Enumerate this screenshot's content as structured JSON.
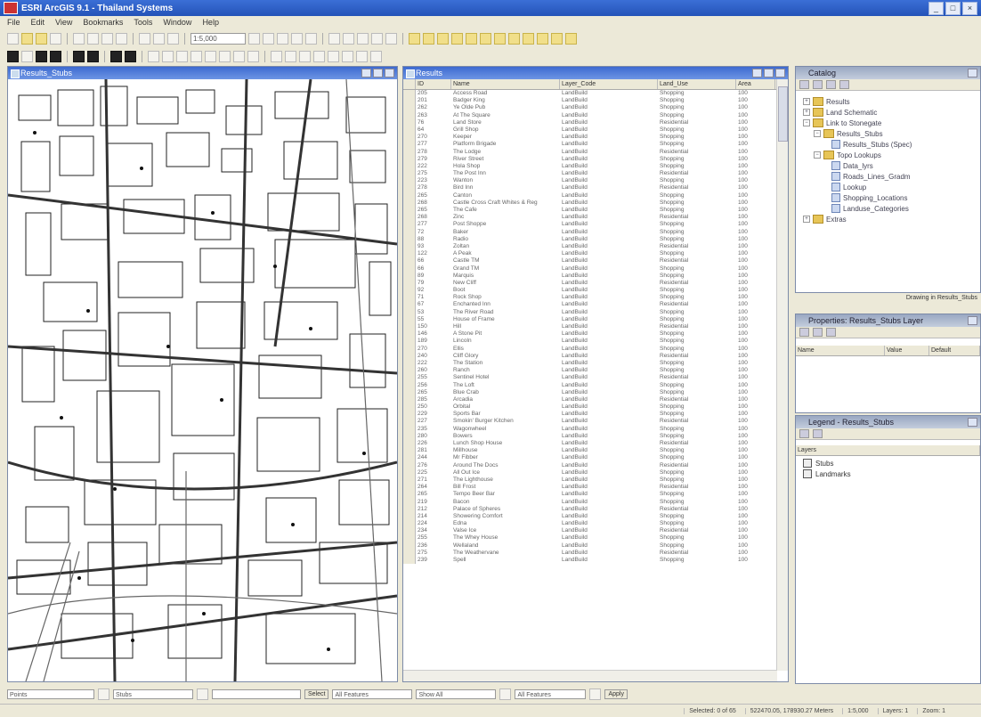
{
  "window": {
    "title": "ESRI ArcGIS 9.1 - Thailand Systems"
  },
  "menu": [
    "File",
    "Edit",
    "View",
    "Bookmarks",
    "Tools",
    "Window",
    "Help"
  ],
  "toolbar": {
    "zoom_value": "1:5,000"
  },
  "map_panel": {
    "title": "Results_Stubs"
  },
  "table_panel": {
    "title": "Results",
    "columns": [
      "ID",
      "Name",
      "Layer_Code",
      "Land_Use",
      "Area"
    ],
    "rows": [
      [
        "205",
        "Access Road",
        "LandBuild",
        "Shopping",
        "100"
      ],
      [
        "201",
        "Badger King",
        "LandBuild",
        "Shopping",
        "100"
      ],
      [
        "262",
        "Ye Olde Pub",
        "LandBuild",
        "Shopping",
        "100"
      ],
      [
        "263",
        "At The Square",
        "LandBuild",
        "Shopping",
        "100"
      ],
      [
        "76",
        "Land Store",
        "LandBuild",
        "Residential",
        "100"
      ],
      [
        "64",
        "Grill Shop",
        "LandBuild",
        "Shopping",
        "100"
      ],
      [
        "270",
        "Keeper",
        "LandBuild",
        "Shopping",
        "100"
      ],
      [
        "277",
        "Platform Brigade",
        "LandBuild",
        "Shopping",
        "100"
      ],
      [
        "278",
        "The Lodge",
        "LandBuild",
        "Residential",
        "100"
      ],
      [
        "279",
        "River Street",
        "LandBuild",
        "Shopping",
        "100"
      ],
      [
        "222",
        "Hola Shop",
        "LandBuild",
        "Shopping",
        "100"
      ],
      [
        "275",
        "The Post Inn",
        "LandBuild",
        "Residential",
        "100"
      ],
      [
        "223",
        "Wanton",
        "LandBuild",
        "Shopping",
        "100"
      ],
      [
        "278",
        "Bird Inn",
        "LandBuild",
        "Residential",
        "100"
      ],
      [
        "265",
        "Canton",
        "LandBuild",
        "Shopping",
        "100"
      ],
      [
        "268",
        "Castle Cross Craft Whites & Reg",
        "LandBuild",
        "Shopping",
        "100"
      ],
      [
        "265",
        "The Cafe",
        "LandBuild",
        "Shopping",
        "100"
      ],
      [
        "268",
        "Zinc",
        "LandBuild",
        "Residential",
        "100"
      ],
      [
        "277",
        "Post Shoppe",
        "LandBuild",
        "Shopping",
        "100"
      ],
      [
        "72",
        "Baker",
        "LandBuild",
        "Shopping",
        "100"
      ],
      [
        "88",
        "Radio",
        "LandBuild",
        "Shopping",
        "100"
      ],
      [
        "93",
        "Zoltan",
        "LandBuild",
        "Residential",
        "100"
      ],
      [
        "122",
        "A Peak",
        "LandBuild",
        "Shopping",
        "100"
      ],
      [
        "66",
        "Castle TM",
        "LandBuild",
        "Residential",
        "100"
      ],
      [
        "66",
        "Grand TM",
        "LandBuild",
        "Shopping",
        "100"
      ],
      [
        "89",
        "Marquis",
        "LandBuild",
        "Shopping",
        "100"
      ],
      [
        "79",
        "New Cliff",
        "LandBuild",
        "Residential",
        "100"
      ],
      [
        "92",
        "Boot",
        "LandBuild",
        "Shopping",
        "100"
      ],
      [
        "71",
        "Rock Shop",
        "LandBuild",
        "Shopping",
        "100"
      ],
      [
        "67",
        "Enchanted Inn",
        "LandBuild",
        "Residential",
        "100"
      ],
      [
        "53",
        "The River Road",
        "LandBuild",
        "Shopping",
        "100"
      ],
      [
        "55",
        "House of Frame",
        "LandBuild",
        "Shopping",
        "100"
      ],
      [
        "150",
        "Hill",
        "LandBuild",
        "Residential",
        "100"
      ],
      [
        "146",
        "A Stone Pit",
        "LandBuild",
        "Shopping",
        "100"
      ],
      [
        "189",
        "Lincoln",
        "LandBuild",
        "Shopping",
        "100"
      ],
      [
        "270",
        "Ellis",
        "LandBuild",
        "Shopping",
        "100"
      ],
      [
        "240",
        "Cliff Glory",
        "LandBuild",
        "Residential",
        "100"
      ],
      [
        "222",
        "The Station",
        "LandBuild",
        "Shopping",
        "100"
      ],
      [
        "260",
        "Ranch",
        "LandBuild",
        "Shopping",
        "100"
      ],
      [
        "255",
        "Sentinel Hotel",
        "LandBuild",
        "Residential",
        "100"
      ],
      [
        "256",
        "The Loft",
        "LandBuild",
        "Shopping",
        "100"
      ],
      [
        "265",
        "Blue Crab",
        "LandBuild",
        "Shopping",
        "100"
      ],
      [
        "285",
        "Arcadia",
        "LandBuild",
        "Residential",
        "100"
      ],
      [
        "250",
        "Orbital",
        "LandBuild",
        "Shopping",
        "100"
      ],
      [
        "229",
        "Sports Bar",
        "LandBuild",
        "Shopping",
        "100"
      ],
      [
        "227",
        "Smokin' Burger Kitchen",
        "LandBuild",
        "Residential",
        "100"
      ],
      [
        "235",
        "Wagonwheel",
        "LandBuild",
        "Shopping",
        "100"
      ],
      [
        "280",
        "Bowers",
        "LandBuild",
        "Shopping",
        "100"
      ],
      [
        "226",
        "Lunch Shop House",
        "LandBuild",
        "Residential",
        "100"
      ],
      [
        "281",
        "Millhouse",
        "LandBuild",
        "Shopping",
        "100"
      ],
      [
        "244",
        "Mr Fibber",
        "LandBuild",
        "Shopping",
        "100"
      ],
      [
        "276",
        "Around The Docs",
        "LandBuild",
        "Residential",
        "100"
      ],
      [
        "225",
        "All Out Ice",
        "LandBuild",
        "Shopping",
        "100"
      ],
      [
        "271",
        "The Lighthouse",
        "LandBuild",
        "Shopping",
        "100"
      ],
      [
        "264",
        "Bill Frost",
        "LandBuild",
        "Residential",
        "100"
      ],
      [
        "265",
        "Tempo Beer Bar",
        "LandBuild",
        "Shopping",
        "100"
      ],
      [
        "219",
        "Bacon",
        "LandBuild",
        "Shopping",
        "100"
      ],
      [
        "212",
        "Palace of Spheres",
        "LandBuild",
        "Residential",
        "100"
      ],
      [
        "214",
        "Showering Comfort",
        "LandBuild",
        "Shopping",
        "100"
      ],
      [
        "224",
        "Edna",
        "LandBuild",
        "Shopping",
        "100"
      ],
      [
        "234",
        "Valse Ice",
        "LandBuild",
        "Residential",
        "100"
      ],
      [
        "255",
        "The Whey House",
        "LandBuild",
        "Shopping",
        "100"
      ],
      [
        "236",
        "Wellaland",
        "LandBuild",
        "Shopping",
        "100"
      ],
      [
        "275",
        "The Weathervane",
        "LandBuild",
        "Residential",
        "100"
      ],
      [
        "239",
        "Spell",
        "LandBuild",
        "Shopping",
        "100"
      ]
    ]
  },
  "catalog": {
    "title": "Catalog",
    "items": [
      "Results",
      "Land Schematic",
      "Link to Stonegate",
      "Results_Stubs",
      "Results_Stubs (Spec)",
      "Topo Lookups",
      "Data_lyrs",
      "Roads_Lines_Gradm",
      "Lookup",
      "Shopping_Locations",
      "Landuse_Categories",
      "Extras"
    ]
  },
  "status_line": {
    "text": "Drawing in Results_Stubs"
  },
  "props_panel": {
    "title": "Properties: Results_Stubs Layer",
    "col1": "Name",
    "col2": "Value",
    "col3": "Default"
  },
  "legend_panel": {
    "title": "Legend - Results_Stubs",
    "header": "Layers",
    "items": [
      "Stubs",
      "Landmarks"
    ]
  },
  "bottom": {
    "field1": "Points",
    "field2": "Stubs",
    "btn1": "Select",
    "field3": "All Features",
    "field4": "Show All",
    "field5": "All Features",
    "btn2": "Apply"
  },
  "statusbar": [
    "Selected: 0 of 65",
    "522470.05, 178930.27 Meters",
    "1:5,000",
    "Layers: 1",
    "Zoom: 1"
  ]
}
